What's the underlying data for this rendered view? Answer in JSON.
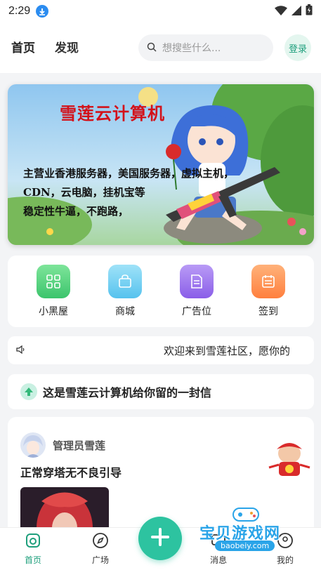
{
  "status_bar": {
    "time": "2:29"
  },
  "top_nav": {
    "tabs": [
      {
        "label": "首页"
      },
      {
        "label": "发现"
      }
    ],
    "search_placeholder": "想搜些什么...",
    "login_label": "登录"
  },
  "banner": {
    "title": "雪莲云计算机",
    "lines": [
      "主营业香港服务器，美国服务器，虚拟主机，",
      "CDN，云电脑，挂机宝等",
      "稳定性牛逼，不跑路，"
    ]
  },
  "quick_actions": [
    {
      "label": "小黑屋",
      "icon": "grid-icon",
      "color": "#4cd07a"
    },
    {
      "label": "商城",
      "icon": "shopping-bag-icon",
      "color": "#5cc8f0"
    },
    {
      "label": "广告位",
      "icon": "document-icon",
      "color": "#9a6cf0"
    },
    {
      "label": "签到",
      "icon": "calendar-icon",
      "color": "#ff8a4c"
    }
  ],
  "notice": {
    "text": "欢迎来到雪莲社区，愿你的"
  },
  "letter": {
    "text": "这是雪莲云计算机给你留的一封信"
  },
  "post": {
    "author": "管理员雪莲",
    "title": "正常穿塔无不良引导"
  },
  "bottom_nav": {
    "items": [
      {
        "label": "首页"
      },
      {
        "label": "广场"
      },
      {
        "label": "消息"
      },
      {
        "label": "我的"
      }
    ]
  },
  "watermark": {
    "text": "宝贝游戏网",
    "url": "baobeiy.com"
  },
  "colors": {
    "accent": "#2dc3a0",
    "accent_text": "#1e9f7c",
    "banner_title": "#d3121a"
  }
}
